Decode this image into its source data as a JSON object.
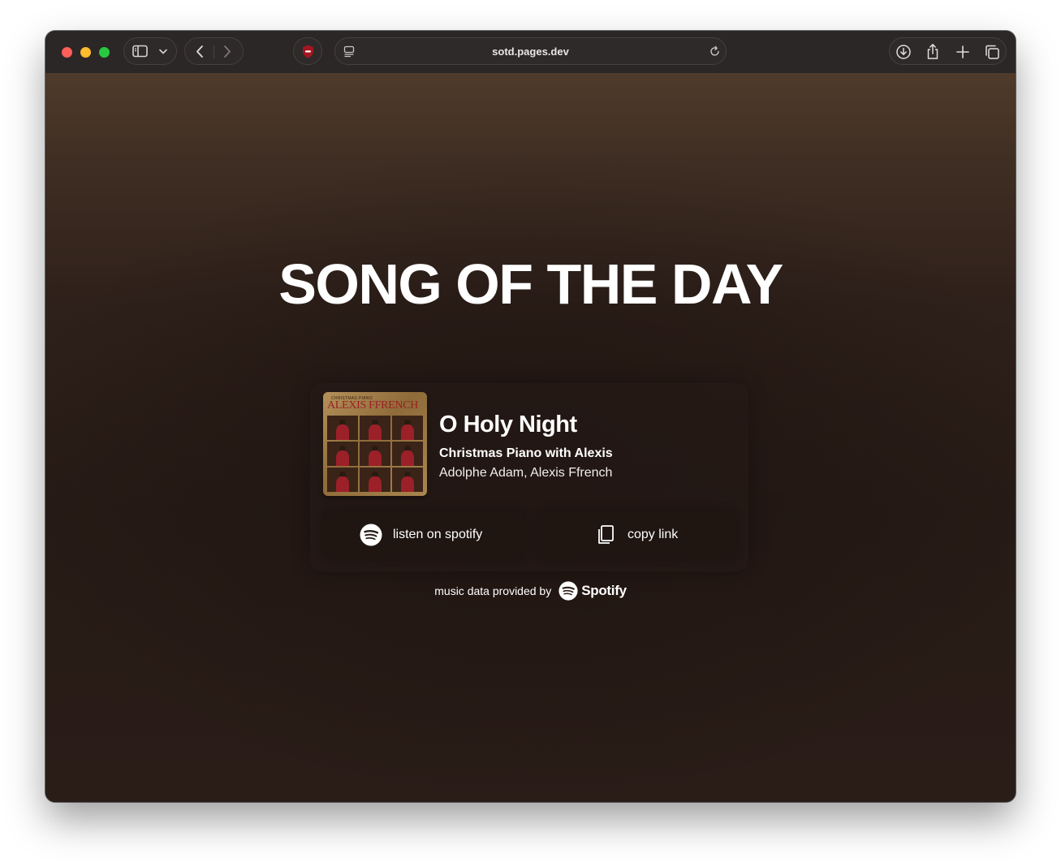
{
  "browser": {
    "url": "sotd.pages.dev"
  },
  "page": {
    "heading": "SONG OF THE DAY",
    "track": {
      "title": "O Holy Night",
      "album": "Christmas Piano with Alexis",
      "artists": "Adolphe Adam, Alexis Ffrench",
      "cover": {
        "top_text": "CHRISTMAS PIANO",
        "name_text": "ALEXIS FFRENCH"
      }
    },
    "buttons": {
      "listen_label": "listen on spotify",
      "copy_label": "copy link"
    },
    "footer": {
      "prefix": "music data provided by",
      "brand": "Spotify"
    }
  },
  "colors": {
    "accent": "#ffffff",
    "background": "#2a1c16"
  }
}
